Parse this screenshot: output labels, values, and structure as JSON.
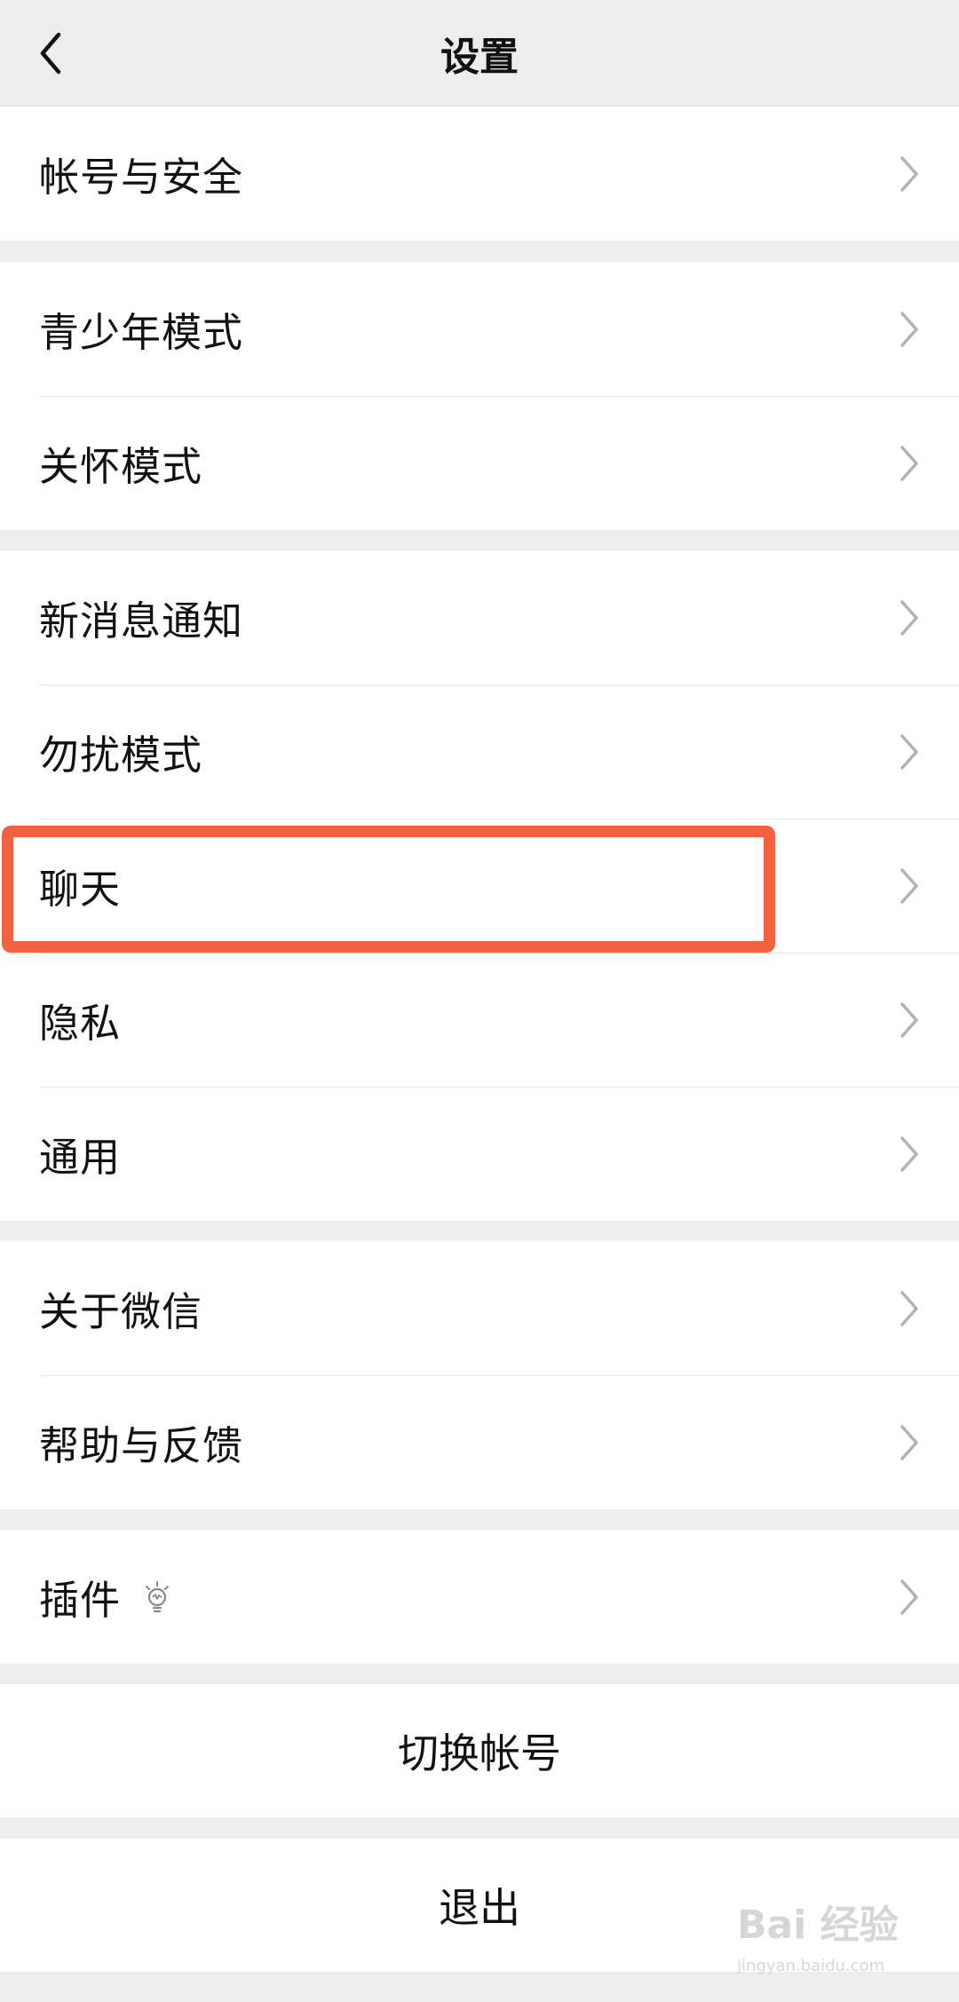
{
  "navbar": {
    "title": "设置",
    "back_icon": "chevron-left-icon"
  },
  "groups": {
    "account": {
      "items": [
        {
          "label": "帐号与安全"
        }
      ]
    },
    "modes": {
      "items": [
        {
          "label": "青少年模式"
        },
        {
          "label": "关怀模式"
        }
      ]
    },
    "settings": {
      "items": [
        {
          "label": "新消息通知"
        },
        {
          "label": "勿扰模式"
        },
        {
          "label": "聊天"
        },
        {
          "label": "隐私"
        },
        {
          "label": "通用"
        }
      ]
    },
    "about": {
      "items": [
        {
          "label": "关于微信"
        },
        {
          "label": "帮助与反馈"
        }
      ]
    },
    "plugins": {
      "items": [
        {
          "label": "插件",
          "icon": "lightbulb-icon"
        }
      ]
    }
  },
  "actions": {
    "switch_account": "切换帐号",
    "logout": "退出"
  },
  "annotation": {
    "highlighted_item": "聊天",
    "color": "#f26140"
  },
  "watermark": {
    "main": "Bai 经验",
    "sub": "jingyan.baidu.com"
  },
  "colors": {
    "background": "#ededed",
    "cell": "#ffffff",
    "divider": "#e5e5e5",
    "arrow": "#b2b2b2"
  }
}
